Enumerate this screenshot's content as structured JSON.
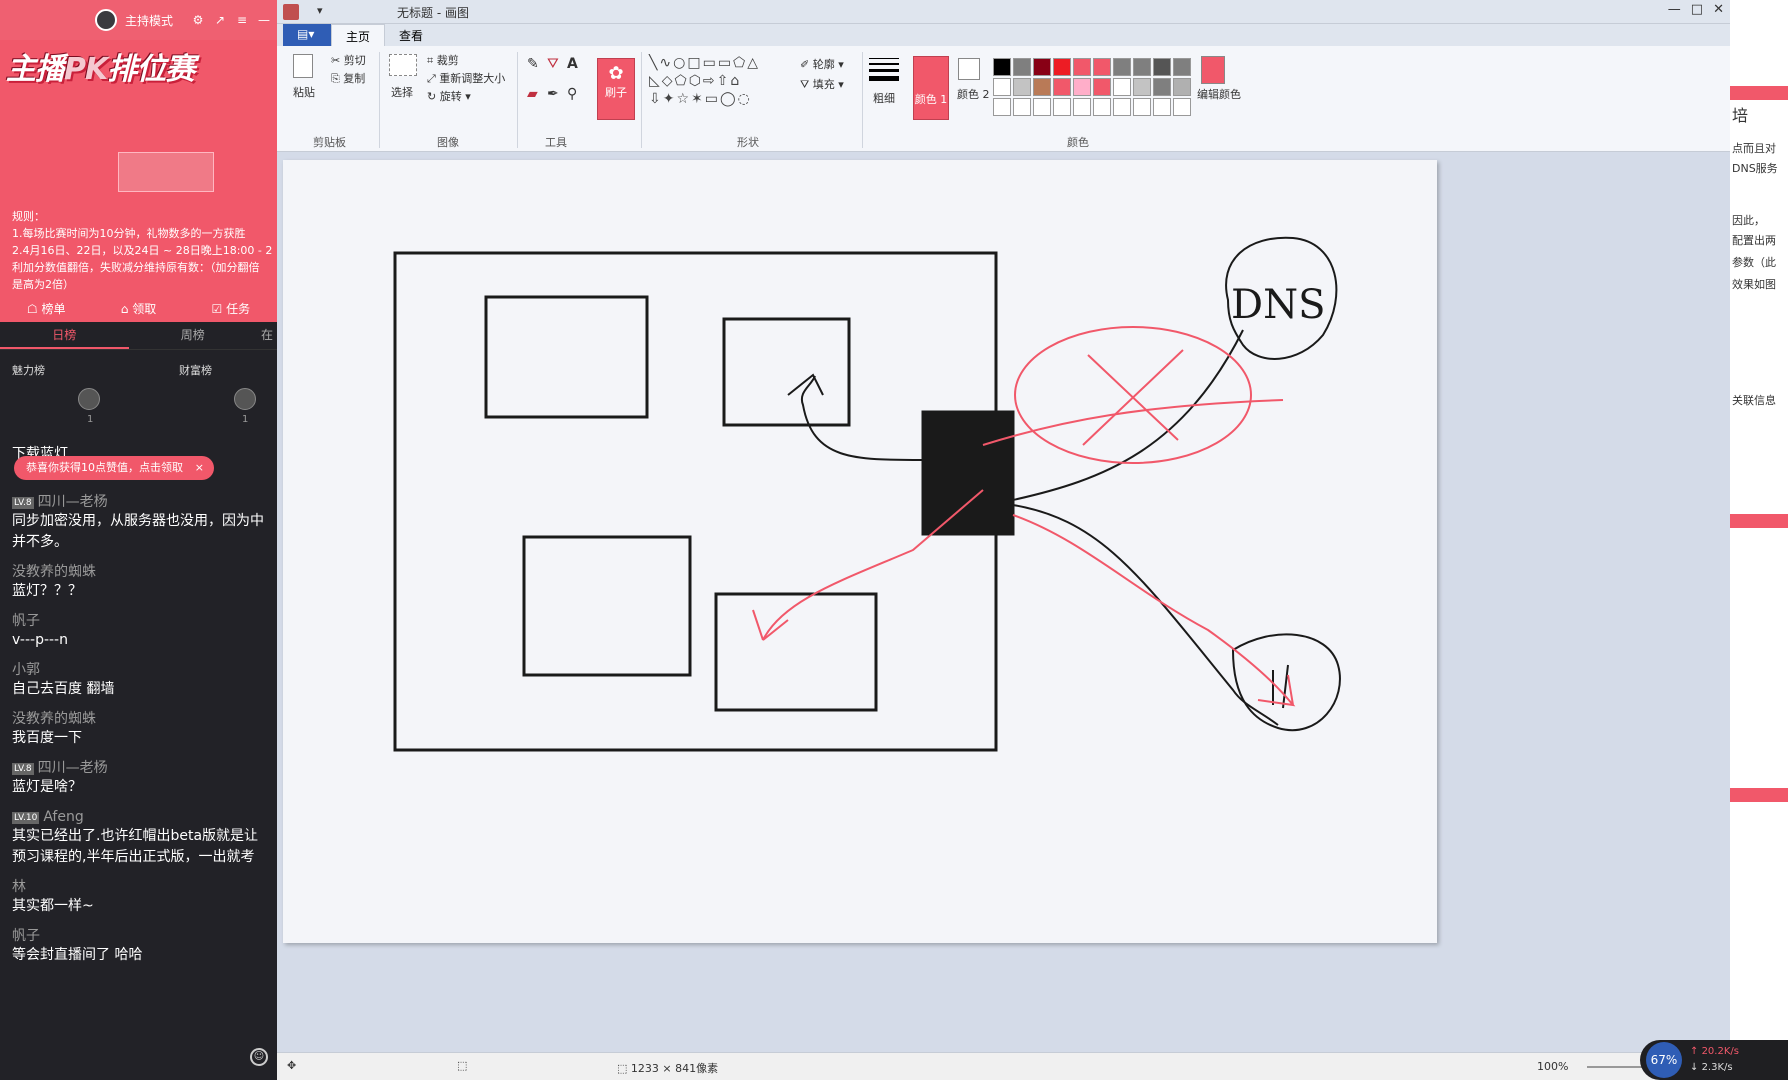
{
  "live": {
    "mode_label": "主持模式",
    "banner_text_a": "主播",
    "banner_text_pk": "PK",
    "banner_text_b": "排位赛",
    "rules_title": "规则：",
    "rules_lines": [
      "1.每场比赛时间为10分钟，礼物数多的一方获胜",
      "2.4月16日、22日，以及24日 ~ 28日晚上18:00 - 2",
      "利加分数值翻倍，失败减分维持原有数：（加分翻倍",
      "是高为2倍）"
    ],
    "actions": [
      "榜单",
      "领取",
      "任务"
    ],
    "rank_tabs": [
      "日榜",
      "周榜",
      "在"
    ],
    "rank_sub": [
      "魅力榜",
      "财富榜"
    ],
    "rank_nums": [
      "1",
      "1"
    ],
    "notice": "恭喜你获得10点赞值，点击领取",
    "notice_close": "×",
    "chat": [
      {
        "user": "下载蓝灯",
        "level": "",
        "text": ""
      },
      {
        "user": "四川—老杨",
        "level": "LV.8",
        "text": "同步加密没用，从服务器也没用，因为中\n并不多。"
      },
      {
        "user": "没教养的蜘蛛",
        "level": "",
        "text": "蓝灯？？？"
      },
      {
        "user": "帆子",
        "level": "",
        "text": "v---p---n"
      },
      {
        "user": "小郭",
        "level": "",
        "text": "自己去百度 翻墙"
      },
      {
        "user": "没教养的蜘蛛",
        "level": "",
        "text": "我百度一下"
      },
      {
        "user": "四川—老杨",
        "level": "LV.8",
        "text": "蓝灯是啥？"
      },
      {
        "user": "Afeng",
        "level": "LV.10",
        "text": "其实已经出了.也许红帽出beta版就是让\n预习课程的,半年后出正式版，一出就考"
      },
      {
        "user": "林",
        "level": "",
        "text": "其实都一样~"
      },
      {
        "user": "帆子",
        "level": "",
        "text": "等会封直播间了 哈哈"
      }
    ]
  },
  "paint": {
    "title": "无标题 - 画图",
    "quick_access": "▾",
    "window_controls": [
      "—",
      "□",
      "✕"
    ],
    "tabs": [
      "▤▾",
      "主页",
      "查看"
    ],
    "ribbon": {
      "paste": "粘贴",
      "cut": "剪切",
      "copy": "复制",
      "clipboard_group": "剪贴板",
      "select": "选择",
      "crop": "裁剪",
      "resize": "重新调整大小",
      "rotate": "旋转 ▾",
      "image_group": "图像",
      "tools_group": "工具",
      "brush": "刷子",
      "outline": "轮廓 ▾",
      "fill": "填充 ▾",
      "shapes_group": "形状",
      "size": "粗细",
      "color1": "颜色 1",
      "color2": "颜色 2",
      "edit_colors": "编辑颜色",
      "colors_group": "颜色",
      "palette": [
        "#000000",
        "#7f7f7f",
        "#880015",
        "#ed1c24",
        "#f1586a",
        "#f1586a",
        "#7f7f7f",
        "#7f7f7f",
        "#555555",
        "#7f7f7f",
        "#ffffff",
        "#c3c3c3",
        "#b97a57",
        "#f1586a",
        "#ffaec9",
        "#f1586a",
        "#ffffff",
        "#c3c3c3",
        "#7f7f7f",
        "#b0b0b0",
        "#ffffff",
        "#ffffff",
        "#ffffff",
        "#ffffff",
        "#ffffff",
        "#ffffff",
        "#ffffff",
        "#ffffff",
        "#ffffff",
        "#ffffff"
      ]
    },
    "status": {
      "canvas_size": "1233 × 841像素",
      "zoom": "100%"
    },
    "drawing": {
      "label_dns": "DNS",
      "stroke_black": "#1a1a1a",
      "stroke_red": "#f1586a"
    }
  },
  "right_strip": {
    "lines": [
      "培",
      "点而且对",
      "DNS服务",
      "因此，",
      "配置出两",
      "参数（此",
      "效果如图",
      "关联信息"
    ]
  },
  "net": {
    "percent": "67%",
    "up": "20.2K/s",
    "down": "2.3K/s"
  },
  "colors": {
    "accent": "#f1586a",
    "panel_bg": "#222227",
    "paint_ribbon": "#f4f6fa"
  }
}
